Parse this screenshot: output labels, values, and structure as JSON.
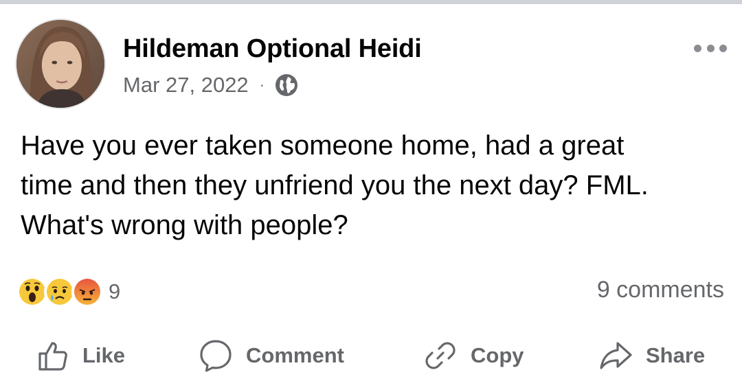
{
  "post": {
    "author": "Hildeman Optional Heidi",
    "date": "Mar 27, 2022",
    "separator": "·",
    "audience_icon": "globe-icon",
    "body_lines": [
      "Have you ever taken someone home, had a great",
      "time and then they unfriend you the next day? FML.",
      "What's wrong with people?"
    ]
  },
  "reactions": {
    "types": [
      "wow",
      "sad",
      "angry"
    ],
    "count": "9"
  },
  "comments": {
    "label": "9 comments"
  },
  "actions": {
    "like": "Like",
    "comment": "Comment",
    "copy": "Copy",
    "share": "Share"
  },
  "colors": {
    "secondary_text": "#65676b",
    "primary_text": "#050505",
    "wow_yellow": "#f7c83a",
    "angry_red": "#e8553e"
  }
}
